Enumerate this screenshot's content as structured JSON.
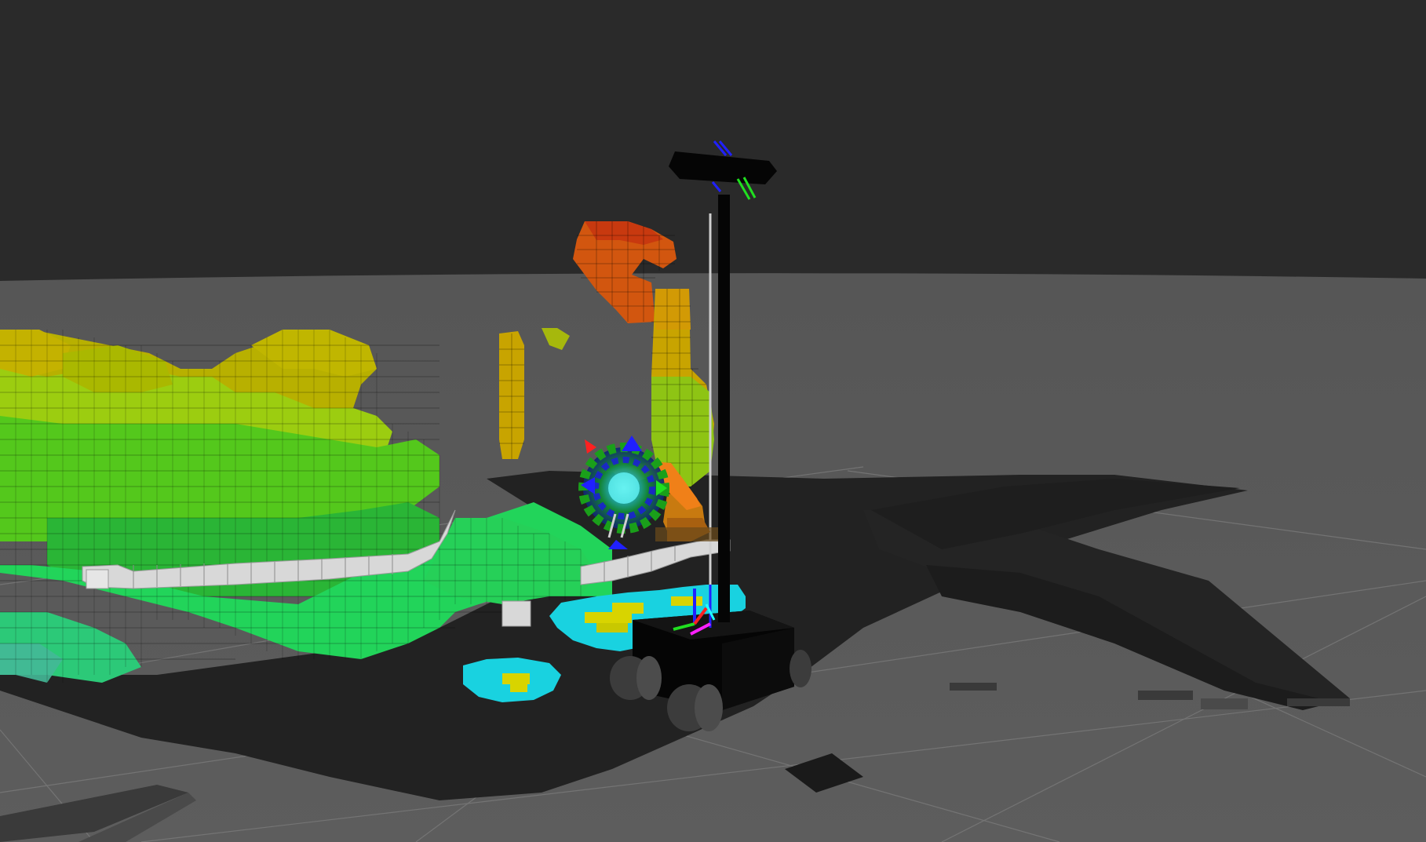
{
  "app": {
    "kind": "3d-visualizer-viewport"
  },
  "scene": {
    "colors": {
      "sky": "#2a2a2a",
      "floor": "#595959",
      "grid_line": "#7a7a7a",
      "costmap_dark": "#1f1f1f",
      "costmap_mid": "#3b3b3b",
      "costmap_light": "#4a4a4a",
      "voxel_yellow": "#c8b400",
      "voxel_lime": "#8ed11a",
      "voxel_green": "#2bc83a",
      "voxel_teal": "#22d68c",
      "voxel_orange": "#e07a10",
      "voxel_red": "#d2470f",
      "inflation_cyan": "#19d2e0",
      "inflation_yellow": "#d8d400",
      "robot_body": "#050505",
      "wheel": "#3c3c3c",
      "arm_orange": "#f08018",
      "frame_x": "#ff2020",
      "frame_y": "#20e020",
      "frame_z": "#2020ff",
      "frame_magenta": "#ff20ff",
      "laser_white": "#d8d8d8"
    },
    "objects": [
      "octomap-voxels",
      "costmap-grid",
      "robot-base",
      "robot-mast",
      "head-sensor",
      "robot-arm",
      "interactive-marker",
      "laser-scan",
      "inflation-zone",
      "tf-frames"
    ]
  }
}
